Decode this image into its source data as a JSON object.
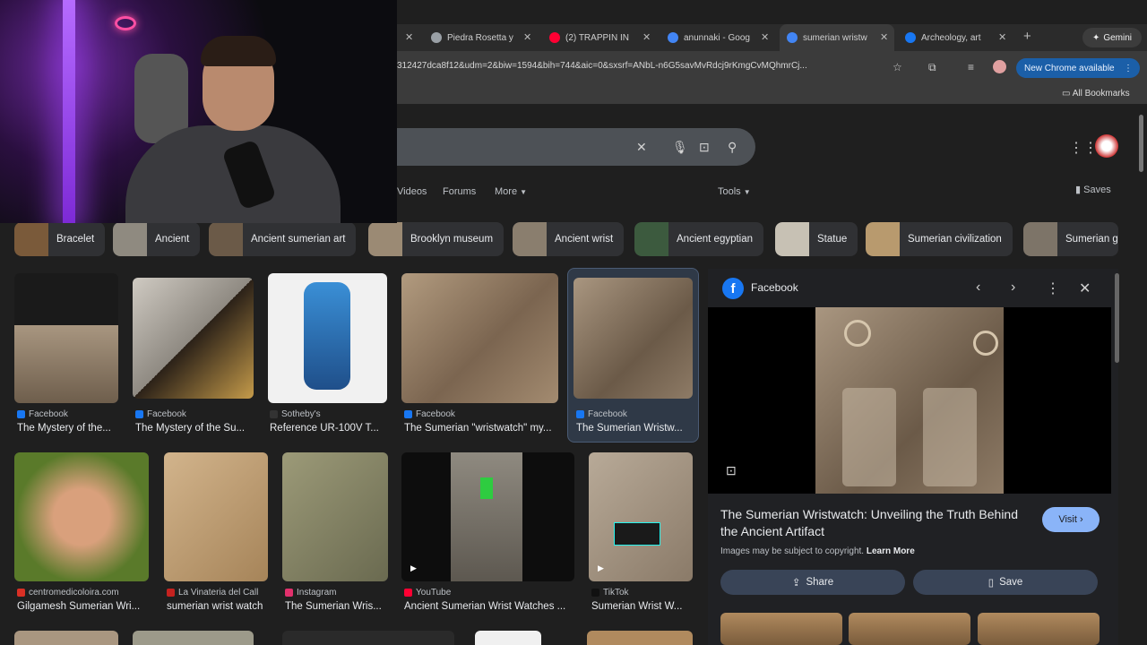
{
  "tabs": [
    {
      "title": "Piedra Rosetta y",
      "icon_color": "#9aa0a6"
    },
    {
      "title": "(2) TRAPPIN IN",
      "icon_color": "#ff0033"
    },
    {
      "title": "anunnaki - Goog",
      "icon_color": "#4285f4"
    },
    {
      "title": "sumerian wristw",
      "icon_color": "#4285f4"
    },
    {
      "title": "Archeology, art",
      "icon_color": "#1877f2"
    }
  ],
  "new_tab": "+",
  "gemini_label": "Gemini",
  "address_bar": {
    "url": "312427dca8f12&udm=2&biw=1594&bih=744&aic=0&sxsrf=ANbL-n6G5savMvRdcj9rKmgCvMQhmrCj..."
  },
  "new_chrome": "New Chrome available",
  "all_bookmarks": "All Bookmarks",
  "nav_tabs": [
    "Videos",
    "Forums",
    "More"
  ],
  "tools_label": "Tools",
  "saves_label": "Saves",
  "chips": [
    {
      "label": "Bracelet",
      "color": "#7a5a3a"
    },
    {
      "label": "Ancient",
      "color": "#8f8a80"
    },
    {
      "label": "Ancient sumerian art",
      "color": "#6b5a48"
    },
    {
      "label": "Brooklyn museum",
      "color": "#9b8a74"
    },
    {
      "label": "Ancient wrist",
      "color": "#8a7e6e"
    },
    {
      "label": "Ancient egyptian",
      "color": "#3c5a3e"
    },
    {
      "label": "Statue",
      "color": "#c7c1b4"
    },
    {
      "label": "Sumerian civilization",
      "color": "#b89a6e"
    },
    {
      "label": "Sumerian g",
      "color": "#7d7468"
    }
  ],
  "results_row1": [
    {
      "source": "Facebook",
      "title": "The Mystery of the...",
      "fav": "#1877f2"
    },
    {
      "source": "Facebook",
      "title": "The Mystery of the Su...",
      "fav": "#1877f2"
    },
    {
      "source": "Sotheby's",
      "title": "Reference UR-100V T...",
      "fav": "#333333"
    },
    {
      "source": "Facebook",
      "title": "The Sumerian \"wristwatch\" my...",
      "fav": "#1877f2"
    },
    {
      "source": "Facebook",
      "title": "The Sumerian Wristw...",
      "fav": "#1877f2"
    }
  ],
  "results_row2": [
    {
      "source": "centromedicoloira.com",
      "title": "Gilgamesh Sumerian Wri...",
      "fav": "#d93025"
    },
    {
      "source": "La Vinateria del Call",
      "title": "sumerian wrist watch",
      "fav": "#c5221f"
    },
    {
      "source": "Instagram",
      "title": "The Sumerian Wris...",
      "fav": "#e1306c"
    },
    {
      "source": "YouTube",
      "title": "Ancient Sumerian Wrist Watches ...",
      "fav": "#ff0033"
    },
    {
      "source": "TikTok",
      "title": "Sumerian Wrist W...",
      "fav": "#111111"
    }
  ],
  "preview": {
    "source": "Facebook",
    "title": "The Sumerian Wristwatch: Unveiling the Truth Behind the Ancient Artifact",
    "visit_label": "Visit",
    "copyright_text": "Images may be subject to copyright.",
    "learn_more": "Learn More",
    "share_label": "Share",
    "save_label": "Save"
  }
}
